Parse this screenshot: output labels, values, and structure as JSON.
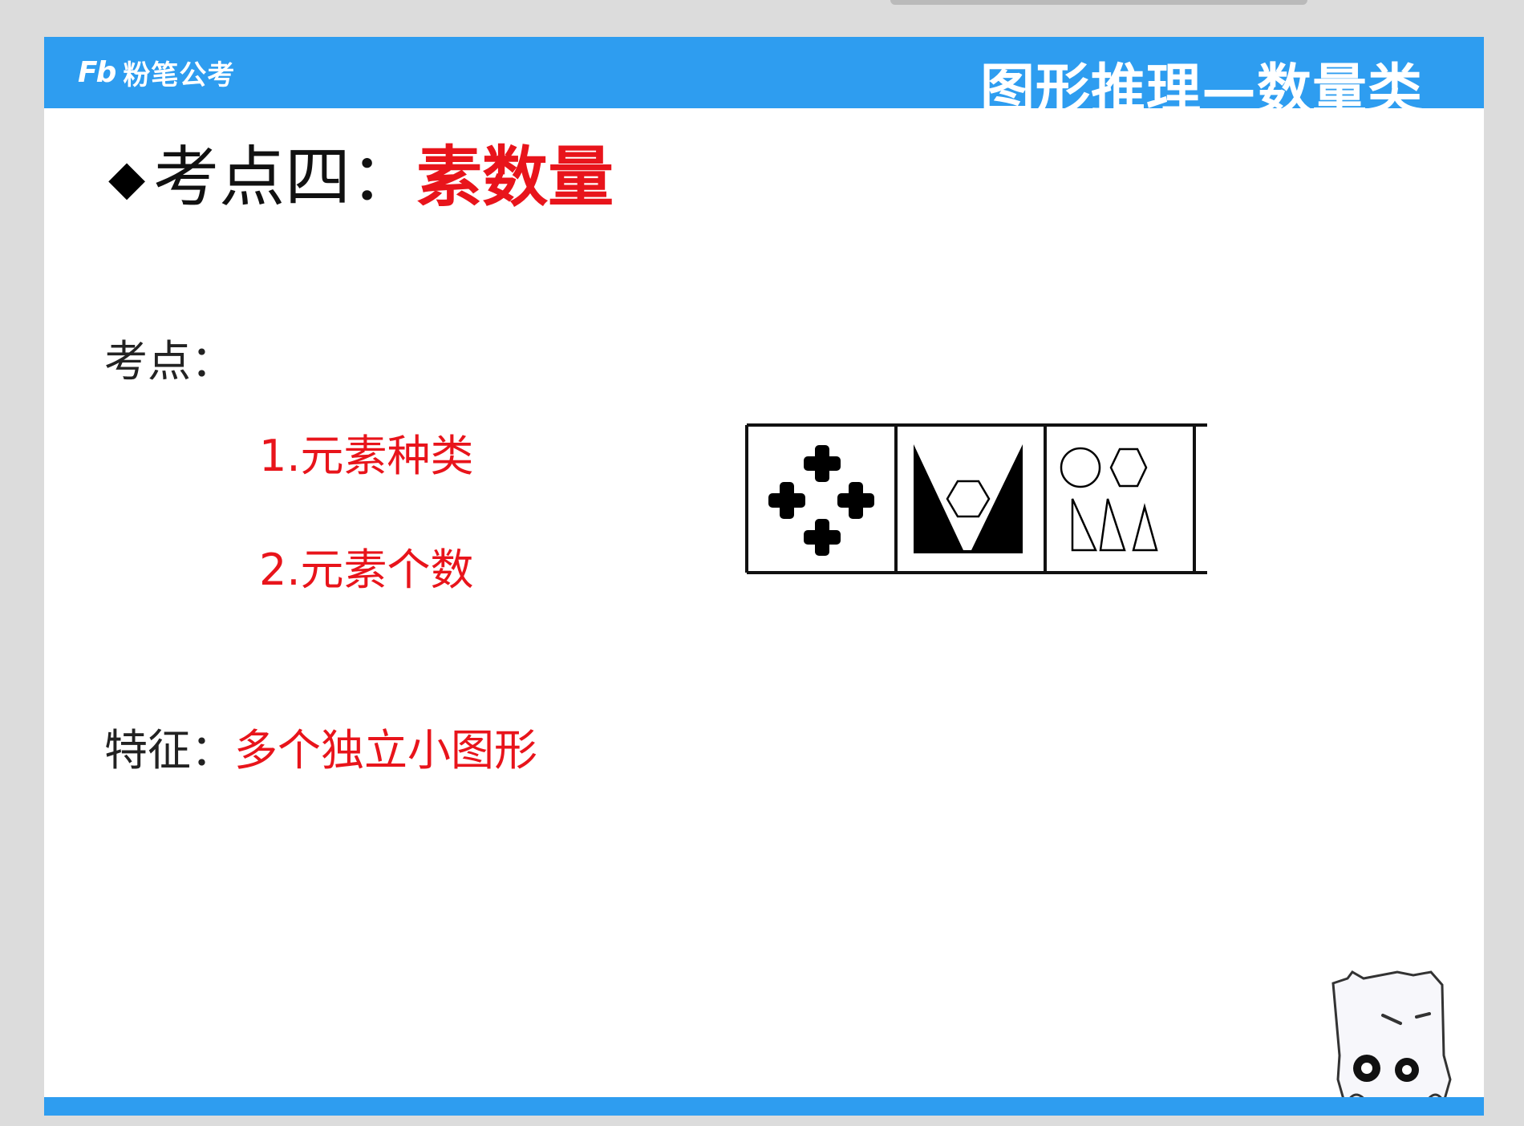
{
  "header": {
    "logo_mark": "Fb",
    "logo_text": "粉笔公考",
    "title": "图形推理—数量类"
  },
  "slide": {
    "bullet": "◆",
    "heading_label": "考点四：",
    "heading_accent": "素数量",
    "points_label": "考点：",
    "points": [
      "1.元素种类",
      "2.元素个数"
    ],
    "feature_label": "特征：",
    "feature_value": "多个独立小图形"
  },
  "figure": {
    "panels": [
      "four-crosses",
      "black-v-with-hexagon",
      "circle-hexagon-triangles"
    ]
  },
  "colors": {
    "accent": "#e8141b",
    "brand_blue": "#2e9df0",
    "background": "#ffffff"
  }
}
